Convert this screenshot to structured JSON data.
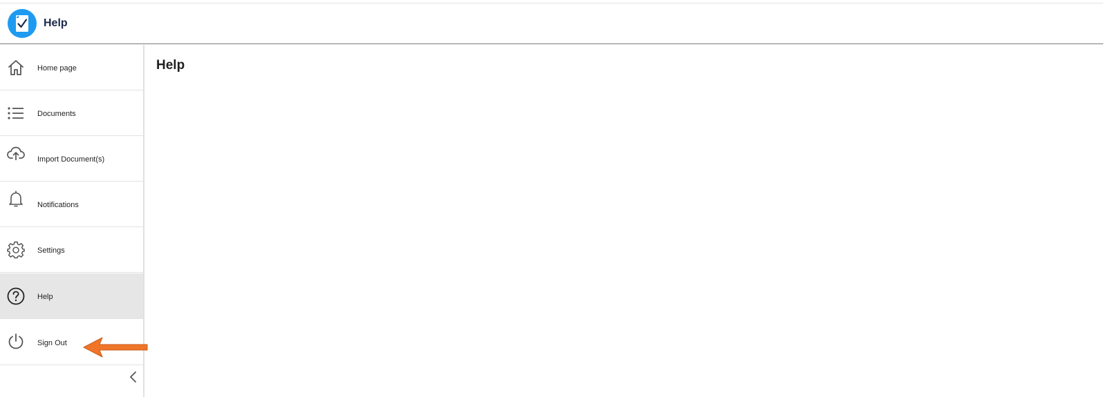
{
  "header": {
    "title": "Help",
    "logo_icon": "document-check-icon",
    "accent": "#1e9bf0"
  },
  "sidebar": {
    "items": [
      {
        "label": "Home page",
        "icon": "home-icon",
        "active": false
      },
      {
        "label": "Documents",
        "icon": "list-icon",
        "active": false
      },
      {
        "label": "Import Document(s)",
        "icon": "cloud-upload-icon",
        "active": false
      },
      {
        "label": "Notifications",
        "icon": "bell-icon",
        "active": false
      },
      {
        "label": "Settings",
        "icon": "gear-icon",
        "active": true
      },
      {
        "label": "Help",
        "icon": "help-circle-icon",
        "active": true
      },
      {
        "label": "Sign Out",
        "icon": "power-icon",
        "active": false
      }
    ],
    "collapse_icon": "chevron-left-icon"
  },
  "main": {
    "title": "Help"
  },
  "annotation": {
    "icon": "arrow-left-icon",
    "color": "#f07528"
  }
}
